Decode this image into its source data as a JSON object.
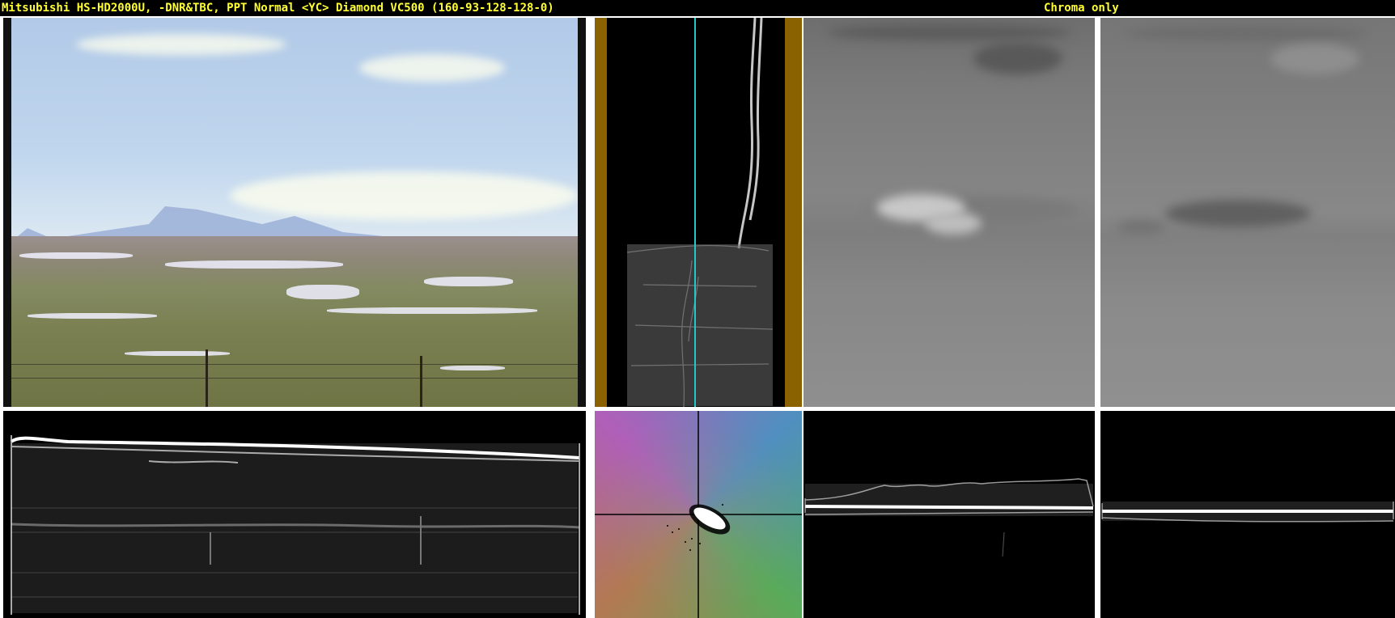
{
  "header": {
    "title": "Mitsubishi HS-HD2000U, -DNR&TBC, PPT Normal <YC> Diamond VC500 (160-93-128-128-0)",
    "mode": "Chroma only"
  },
  "panels": {
    "video_frame": {
      "icon": "landscape-video-frame"
    },
    "vertical_waveform": {
      "icon": "vertical-waveform"
    },
    "channel_1": {
      "icon": "grey-channel-image"
    },
    "channel_2": {
      "icon": "grey-channel-image"
    },
    "luma_waveform": {
      "icon": "waveform-trace"
    },
    "vectorscope": {
      "icon": "vectorscope"
    },
    "channel_1_waveform": {
      "icon": "waveform-trace"
    },
    "channel_2_waveform": {
      "icon": "waveform-trace"
    }
  },
  "colors": {
    "title_text": "#ffff33",
    "title_bg": "#000000",
    "vwave_border": "#8a6200",
    "vwave_marker": "#1fc9c9"
  }
}
